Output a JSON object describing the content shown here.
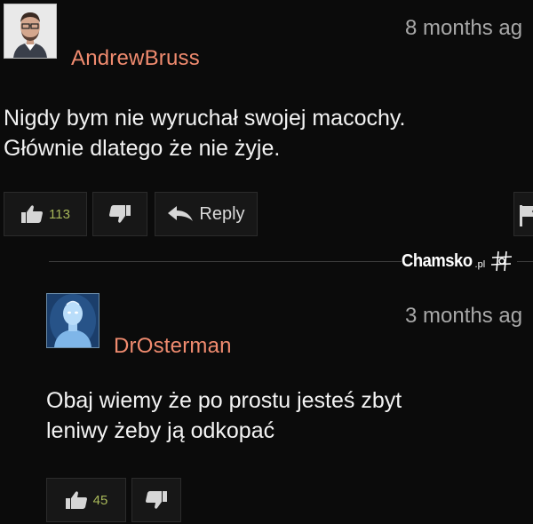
{
  "comments": [
    {
      "username": "AndrewBruss",
      "username_color": "#f08b6f",
      "timestamp": "8 months ag",
      "body_lines": [
        "Nigdy bym nie wyruchał swojej macochy.",
        "Głównie dlatego że nie żyje."
      ],
      "likes": "113",
      "reply_label": "Reply",
      "avatar_icon": "portrait-photo"
    },
    {
      "username": "DrOsterman",
      "username_color": "#f08b6f",
      "timestamp": "3 months ag",
      "body_lines": [
        "Obaj wiemy że po prostu jesteś zbyt",
        "leniwy żeby ją odkopać"
      ],
      "likes": "45",
      "avatar_icon": "glowing-blue-figure"
    }
  ],
  "watermark": {
    "name": "Chamsko",
    "tld": ".pl",
    "icon": "hash-icon"
  },
  "colors": {
    "background": "#0b0b0b",
    "button_bg": "#171717",
    "like_count": "#a8b85a",
    "timestamp": "#a8a8a8"
  }
}
